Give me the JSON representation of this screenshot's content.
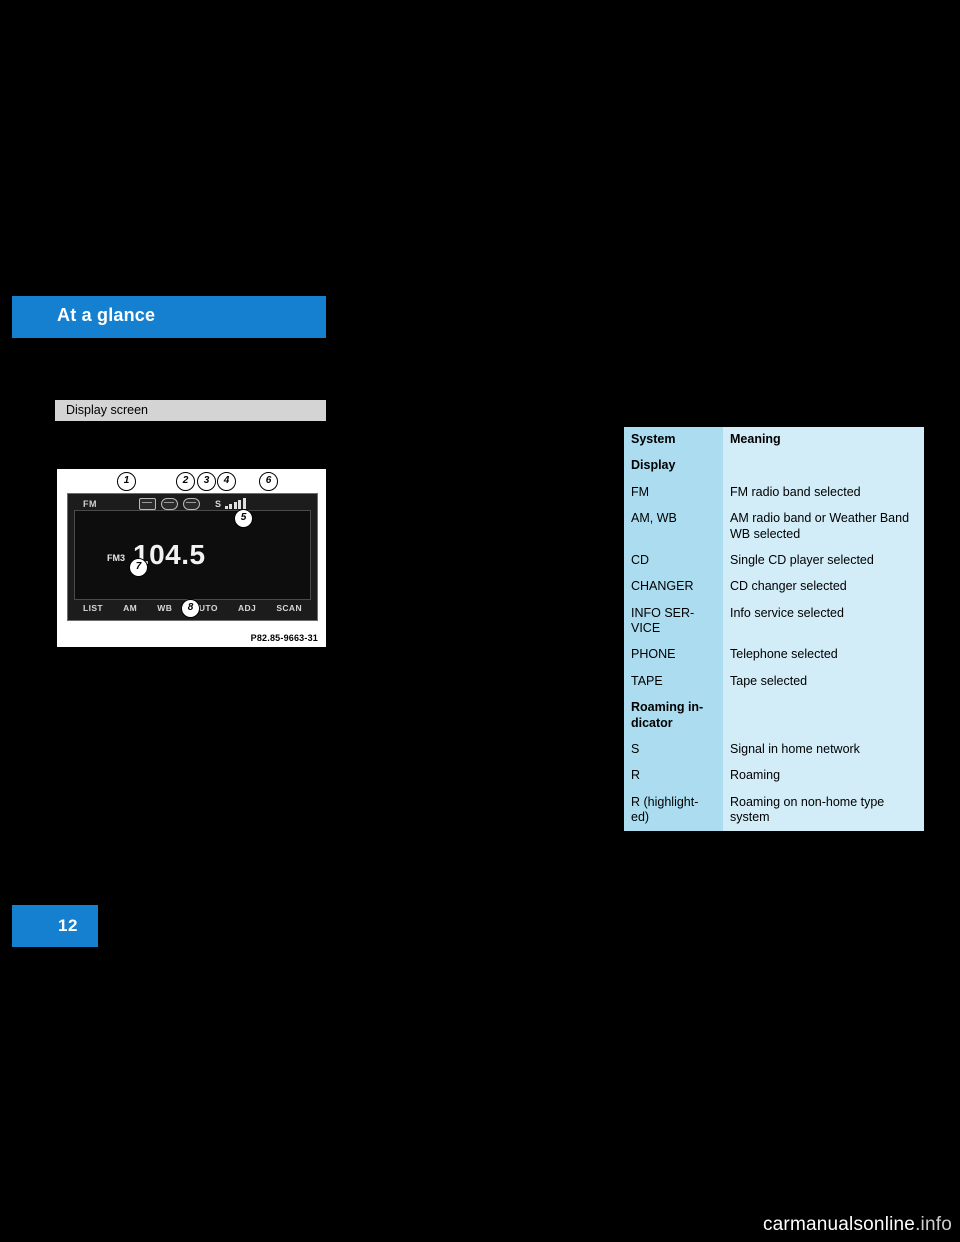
{
  "header": {
    "title": "At a glance"
  },
  "section": {
    "title": "Display screen"
  },
  "figure": {
    "code": "P82.85-9663-31",
    "screen": {
      "band": "FM",
      "preset": "FM3",
      "frequency": "104.5",
      "signal_letter": "S",
      "softkeys": [
        "LIST",
        "AM",
        "WB",
        "AUTO",
        "ADJ",
        "SCAN"
      ]
    },
    "callouts": [
      "1",
      "2",
      "3",
      "4",
      "6",
      "5",
      "7",
      "8"
    ]
  },
  "page": {
    "number": "12"
  },
  "table": {
    "headers": [
      "System",
      "Meaning"
    ],
    "rows": [
      {
        "a": "Display",
        "b": "",
        "bold_a": true
      },
      {
        "a": "FM",
        "b": "FM radio band selected",
        "bold_a": false
      },
      {
        "a": "AM, WB",
        "b": "AM radio band or Weather Band WB selected",
        "bold_a": false
      },
      {
        "a": "CD",
        "b": "Single CD player selected",
        "bold_a": false
      },
      {
        "a": "CHANGER",
        "b": "CD changer selected",
        "bold_a": false
      },
      {
        "a": "INFO SER-VICE",
        "b": "Info service selected",
        "bold_a": false
      },
      {
        "a": "PHONE",
        "b": "Telephone selected",
        "bold_a": false
      },
      {
        "a": "TAPE",
        "b": "Tape selected",
        "bold_a": false
      },
      {
        "a": "Roaming in-dicator",
        "b": "",
        "bold_a": true
      },
      {
        "a": "S",
        "b": "Signal in home network",
        "bold_a": false
      },
      {
        "a": "R",
        "b": "Roaming",
        "bold_a": false
      },
      {
        "a": "R (highlight-ed)",
        "b": "Roaming on non-home type system",
        "bold_a": false
      }
    ]
  },
  "footer": {
    "watermark_main": "carmanualsonline",
    "watermark_ext": ".info"
  }
}
